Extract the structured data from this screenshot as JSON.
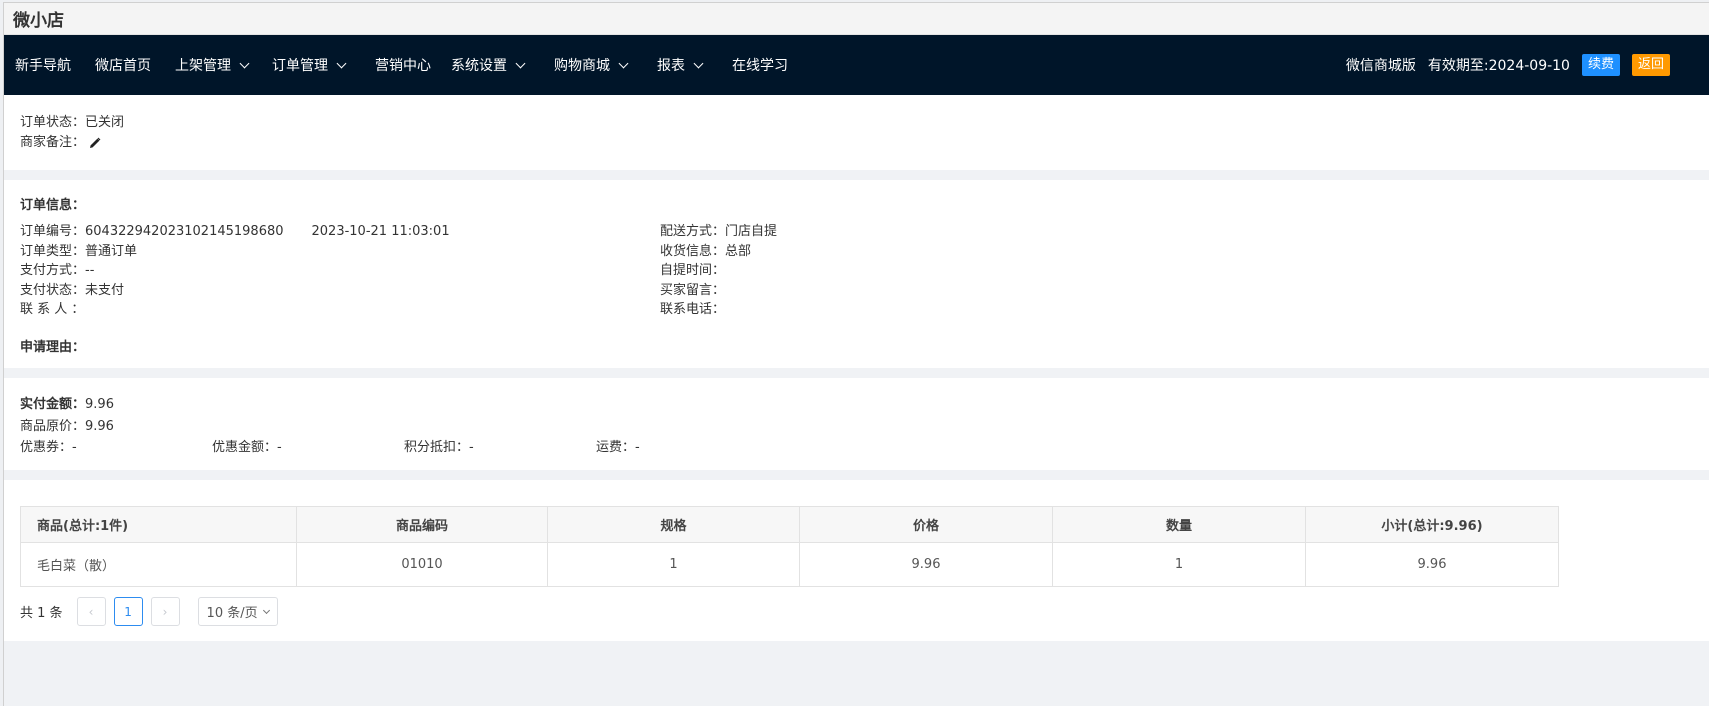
{
  "app": {
    "title": "微小店"
  },
  "nav": {
    "items": [
      {
        "label": "新手导航",
        "dropdown": false
      },
      {
        "label": "微店首页",
        "dropdown": false
      },
      {
        "label": "上架管理",
        "dropdown": true
      },
      {
        "label": "订单管理",
        "dropdown": true
      },
      {
        "label": "营销中心",
        "dropdown": false
      },
      {
        "label": "系统设置",
        "dropdown": true
      },
      {
        "label": "购物商城",
        "dropdown": true
      },
      {
        "label": "报表",
        "dropdown": true
      },
      {
        "label": "在线学习",
        "dropdown": false
      }
    ],
    "plan": "微信商城版",
    "expiry": "有效期至:2024-09-10",
    "renew_label": "续费",
    "back_label": "返回"
  },
  "status": {
    "order_status": "订单状态：已关闭",
    "merchant_note": "商家备注："
  },
  "info": {
    "heading": "订单信息：",
    "order_no": "订单编号：60432294202310214519868​0",
    "order_time": "2023-10-21 11:03:01",
    "order_type": "订单类型：普通订单",
    "pay_method": "支付方式：--",
    "pay_status": "支付状态：未支付",
    "contact": "联 系 人 ：",
    "delivery": "配送方式：门店自提",
    "receiver": "收货信息：总部",
    "pickup_time": "自提时间：",
    "buyer_msg": "买家留言：",
    "phone": "联系电话：",
    "apply_reason": "申请理由："
  },
  "amount": {
    "paid_label": "实付金额：",
    "paid_value": "9.96",
    "original": "商品原价：9.96",
    "coupon": "优惠券：-",
    "discount": "优惠金额：-",
    "points": "积分抵扣：-",
    "shipping": "运费：-"
  },
  "table": {
    "headers": [
      "商品(总计:1件)",
      "商品编码",
      "规格",
      "价格",
      "数量",
      "小计(总计:9.96)"
    ],
    "rows": [
      [
        "毛白菜（散）",
        "01010",
        "1",
        "9.96",
        "1",
        "9.96"
      ]
    ]
  },
  "pager": {
    "total": "共 1 条",
    "prev": "‹",
    "current": "1",
    "next": "›",
    "page_size": "10 条/页"
  },
  "colors": {
    "nav_bg": "#001529",
    "renew": "#1e90ff",
    "back": "#ff9900",
    "active_page": "#2d8cf0"
  }
}
